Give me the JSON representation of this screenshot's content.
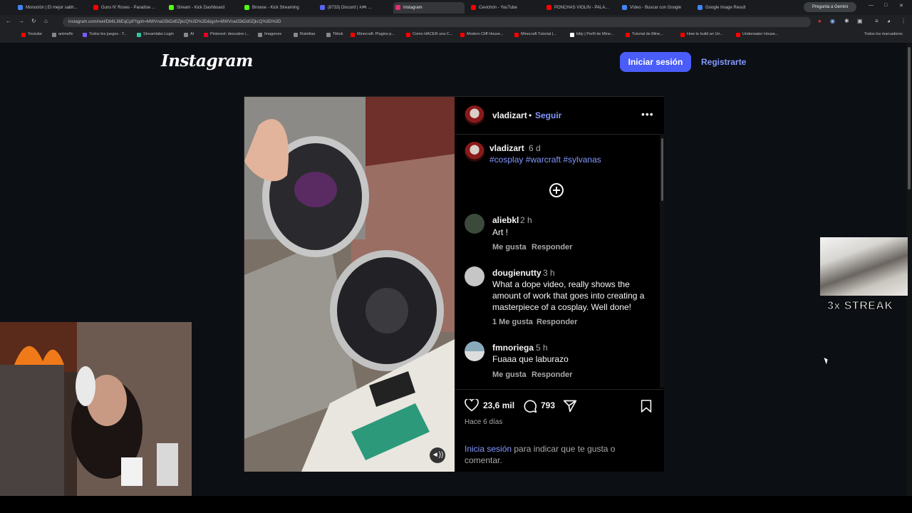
{
  "browser": {
    "tabs": [
      {
        "label": "Monoclón | El mejor sabh...",
        "color": "#4285f4"
      },
      {
        "label": "Guns N' Roses - Paradise ...",
        "color": "#ff0000"
      },
      {
        "label": "Stream - Kick Dashboard",
        "color": "#53fc18"
      },
      {
        "label": "Browse - Kick Streaming",
        "color": "#53fc18"
      },
      {
        "label": "(8733) Discord | #🎮 ...",
        "color": "#5865f2"
      },
      {
        "label": "Instagram",
        "color": "#e1306c"
      },
      {
        "label": "Cevichón - YouTube",
        "color": "#ff0000"
      },
      {
        "label": "PONCHAS VIOLIN - PALA...",
        "color": "#ff0000"
      },
      {
        "label": "Vídeo - Buscar con Google",
        "color": "#4285f4"
      },
      {
        "label": "Google Image Result",
        "color": "#4285f4"
      }
    ],
    "gemini_label": "Pregunta a Gemini",
    "url": "instagram.com/reel/Db6L36EqCpf/?igsh=MWVnaG5kDd0ZjkcQ%3D%3D&igsh=MWVnaG5kDd0ZjkcQ%3D%3D",
    "bookmarks": [
      {
        "label": "Youtube",
        "color": "#ff0000"
      },
      {
        "label": "animeflv",
        "color": "#888"
      },
      {
        "label": "Todos los juegos - T...",
        "color": "#7b5cff"
      },
      {
        "label": "Streamlabs Login",
        "color": "#31c3a2"
      },
      {
        "label": "AI",
        "color": "#888"
      },
      {
        "label": "Pinterest: descubre i...",
        "color": "#e60023"
      },
      {
        "label": "Imagenes",
        "color": "#888"
      },
      {
        "label": "Ruletitas",
        "color": "#888"
      },
      {
        "label": "Tiktok",
        "color": "#888"
      },
      {
        "label": "Minecraft: Plugins p...",
        "color": "#ff0000"
      },
      {
        "label": "Como HACER una C...",
        "color": "#ff0000"
      },
      {
        "label": "Modern Cliff House...",
        "color": "#ff0000"
      },
      {
        "label": "Minecraft Tutorial |...",
        "color": "#ff0000"
      },
      {
        "label": "kitty | Perfil de Mine...",
        "color": "#fff"
      },
      {
        "label": "Tutorial de Mine...",
        "color": "#ff0000"
      },
      {
        "label": "How to build an Un...",
        "color": "#ff0000"
      },
      {
        "label": "Underwater House...",
        "color": "#ff0000"
      }
    ],
    "all_bookmarks": "Todos los marcadores"
  },
  "instagram": {
    "logo": "Instagram",
    "login_label": "Iniciar sesión",
    "signup_label": "Registrarte",
    "post": {
      "author": "vladizart",
      "dot": "•",
      "follow_label": "Seguir",
      "more": "•••",
      "caption": {
        "user": "vladizart",
        "time": "6 d",
        "tags": "#cosplay #warcraft #sylvanas"
      },
      "comments": [
        {
          "user": "aliebkl",
          "time": "2 h",
          "text": "Art !",
          "actions": [
            "Me gusta",
            "Responder"
          ]
        },
        {
          "user": "dougienutty",
          "time": "3 h",
          "text": "What a dope video, really shows the amount of work that goes into creating a masterpiece of a cosplay. Well done!",
          "actions": [
            "1 Me gusta",
            "Responder"
          ]
        },
        {
          "user": "fmnoriega",
          "time": "5 h",
          "text": "Fuaaa que laburazo",
          "actions": [
            "Me gusta",
            "Responder"
          ]
        }
      ],
      "likes": "23,6 mil",
      "comment_count": "793",
      "posted_ago": "Hace 6 días",
      "login_prompt_link": "Inicia sesión",
      "login_prompt_rest": " para indicar que te gusta o comentar."
    }
  },
  "overlay": {
    "streak_text": "3x STREAK"
  }
}
